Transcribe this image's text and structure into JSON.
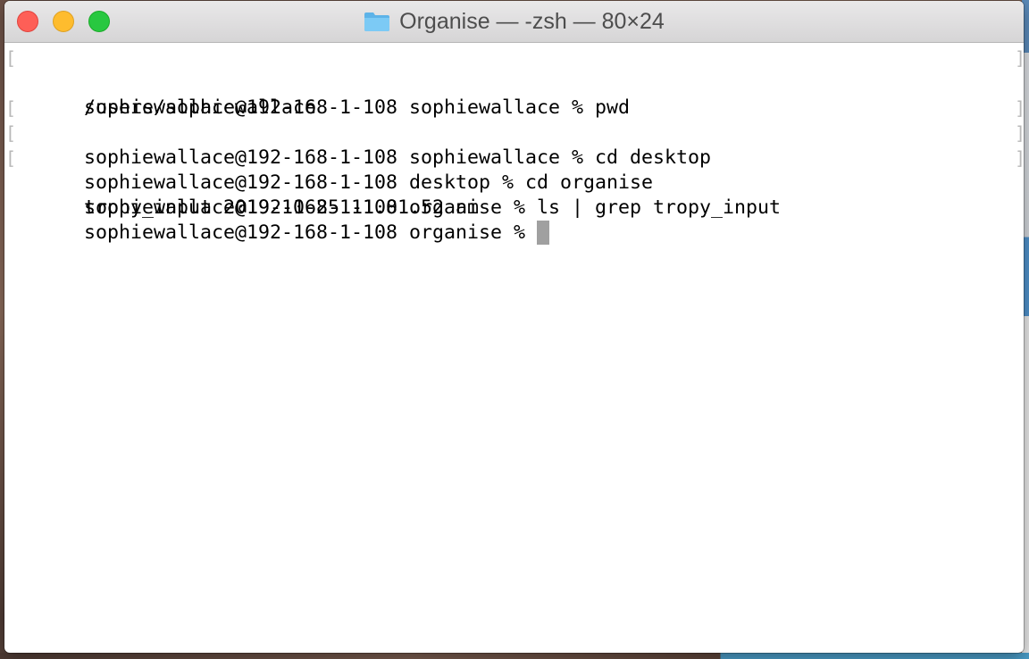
{
  "window": {
    "title": "Organise — -zsh — 80×24",
    "folder_icon": "folder-icon",
    "accent_colors": {
      "close": "#fe5f57",
      "minimize": "#febc2e",
      "zoom": "#28c840",
      "folder": "#6cc3f2"
    }
  },
  "terminal": {
    "lines": [
      {
        "text": "sophiewallace@192-168-1-108 sophiewallace % pwd",
        "marked": true
      },
      {
        "text": "/users/sophiewallace",
        "marked": false
      },
      {
        "text": "sophiewallace@192-168-1-108 sophiewallace % cd desktop",
        "marked": true
      },
      {
        "text": "sophiewallace@192-168-1-108 desktop % cd organise",
        "marked": true
      },
      {
        "text": "sophiewallace@192-168-1-108 organise % ls | grep tropy_input",
        "marked": true
      },
      {
        "text": "tropy_input 2019-10-25 11.01.52 am",
        "marked": false
      },
      {
        "text": "sophiewallace@192-168-1-108 organise % ",
        "marked": false
      }
    ],
    "mark_left": "[",
    "mark_right": "]",
    "cursor_color": "#a0a0a0"
  }
}
